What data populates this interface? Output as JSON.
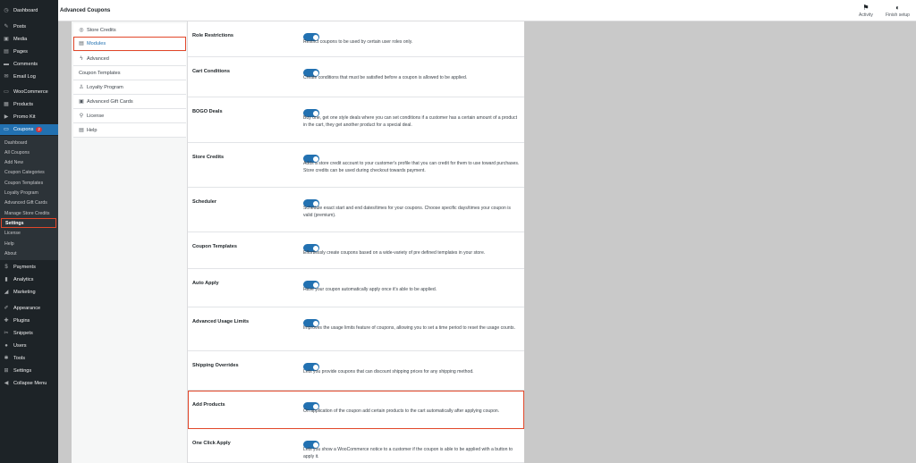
{
  "admin_menu": {
    "items": [
      {
        "label": "Dashboard",
        "icon": "dashboard-icon",
        "glyph": "◷"
      },
      {
        "label": "Posts",
        "icon": "pin-icon",
        "glyph": "✎"
      },
      {
        "label": "Media",
        "icon": "media-icon",
        "glyph": "▣"
      },
      {
        "label": "Pages",
        "icon": "pages-icon",
        "glyph": "▤"
      },
      {
        "label": "Comments",
        "icon": "comments-icon",
        "glyph": "▬"
      },
      {
        "label": "Email Log",
        "icon": "email-icon",
        "glyph": "✉"
      },
      {
        "label": "WooCommerce",
        "icon": "woocommerce-icon",
        "glyph": "▭"
      },
      {
        "label": "Products",
        "icon": "products-icon",
        "glyph": "▦"
      },
      {
        "label": "Promo Kit",
        "icon": "promo-icon",
        "glyph": "▶"
      },
      {
        "label": "Coupons",
        "icon": "coupons-icon",
        "glyph": "▭",
        "badge": "2"
      },
      {
        "label": "Payments",
        "icon": "payments-icon",
        "glyph": "$"
      },
      {
        "label": "Analytics",
        "icon": "analytics-icon",
        "glyph": "▮"
      },
      {
        "label": "Marketing",
        "icon": "marketing-icon",
        "glyph": "◢"
      },
      {
        "label": "Appearance",
        "icon": "appearance-icon",
        "glyph": "✐"
      },
      {
        "label": "Plugins",
        "icon": "plugins-icon",
        "glyph": "✚"
      },
      {
        "label": "Snippets",
        "icon": "snippets-icon",
        "glyph": "✂"
      },
      {
        "label": "Users",
        "icon": "users-icon",
        "glyph": "●"
      },
      {
        "label": "Tools",
        "icon": "tools-icon",
        "glyph": "✱"
      },
      {
        "label": "Settings",
        "icon": "settings-icon",
        "glyph": "⊞"
      },
      {
        "label": "Collapse Menu",
        "icon": "collapse-icon",
        "glyph": "◀"
      }
    ],
    "submenu": [
      "Dashboard",
      "All Coupons",
      "Add New",
      "Coupon Categories",
      "Coupon Templates",
      "Loyalty Program",
      "Advanced Gift Cards",
      "Manage Store Credits",
      "Settings",
      "License",
      "Help",
      "About"
    ]
  },
  "topbar": {
    "title": "Advanced Coupons",
    "activity": "Activity",
    "finish_setup": "Finish setup"
  },
  "settings_nav": [
    {
      "label": "Store Credits",
      "icon": "store-credits-icon",
      "glyph": "◎"
    },
    {
      "label": "Modules",
      "icon": "modules-icon",
      "glyph": "▤"
    },
    {
      "label": "Advanced",
      "icon": "advanced-icon",
      "glyph": "ϟ"
    },
    {
      "label": "Coupon Templates",
      "icon": "",
      "glyph": ""
    },
    {
      "label": "Loyalty Program",
      "icon": "loyalty-icon",
      "glyph": "♙"
    },
    {
      "label": "Advanced Gift Cards",
      "icon": "gift-cards-icon",
      "glyph": "▣"
    },
    {
      "label": "License",
      "icon": "license-icon",
      "glyph": "⚲"
    },
    {
      "label": "Help",
      "icon": "help-icon",
      "glyph": "▤"
    }
  ],
  "modules": [
    {
      "name": "Role Restrictions",
      "enabled": true,
      "desc": "Restrict coupons to be used by certain user roles only."
    },
    {
      "name": "Cart Conditions",
      "enabled": true,
      "desc": "Create conditions that must be satisfied before a coupon is allowed to be applied."
    },
    {
      "name": "BOGO Deals",
      "enabled": true,
      "desc": "Buy one, get one style deals where you can set conditions if a customer has a certain amount of a product in the cart, they get another product for a special deal."
    },
    {
      "name": "Store Credits",
      "enabled": true,
      "desc": "Adds a store credit account to your customer's profile that you can credit for them to use toward purchases. Store credits can be used during checkout towards payment."
    },
    {
      "name": "Scheduler",
      "enabled": true,
      "desc": "Schedule exact start and end dates/times for your coupons. Choose specific days/times your coupon is valid (premium)."
    },
    {
      "name": "Coupon Templates",
      "enabled": true,
      "desc": "Effortlessly create coupons based on a wide-variety of pre defined templates in your store."
    },
    {
      "name": "Auto Apply",
      "enabled": true,
      "desc": "Have your coupon automatically apply once it's able to be applied."
    },
    {
      "name": "Advanced Usage Limits",
      "enabled": true,
      "desc": "Improves the usage limits feature of coupons, allowing you to set a time period to reset the usage counts."
    },
    {
      "name": "Shipping Overrides",
      "enabled": true,
      "desc": "Lets you provide coupons that can discount shipping prices for any shipping method."
    },
    {
      "name": "Add Products",
      "enabled": true,
      "desc": "On application of the coupon add certain products to the cart automatically after applying coupon."
    },
    {
      "name": "One Click Apply",
      "enabled": true,
      "desc": "Lets you show a WooCommerce notice to a customer if the coupon is able to be applied with a button to apply it."
    }
  ]
}
